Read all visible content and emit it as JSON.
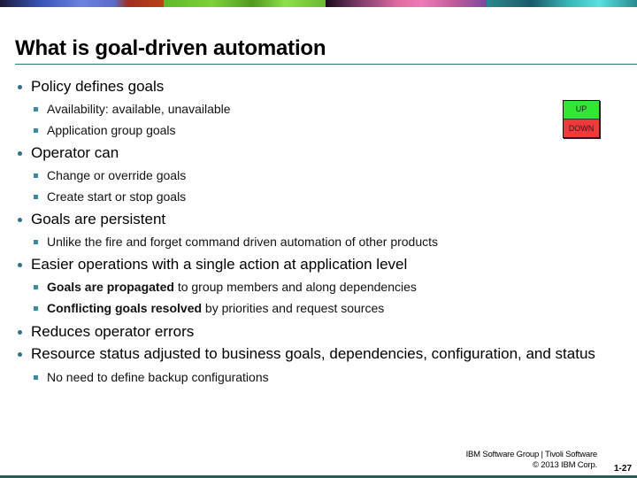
{
  "slide": {
    "title": "What is goal-driven automation",
    "bullets": [
      {
        "text": "Policy defines goals",
        "children": [
          {
            "text": "Availability: available, unavailable"
          },
          {
            "text": "Application group goals"
          }
        ]
      },
      {
        "text": "Operator can",
        "children": [
          {
            "text": "Change or override goals"
          },
          {
            "text": "Create start or stop goals"
          }
        ]
      },
      {
        "text": "Goals are persistent",
        "children": [
          {
            "text": "Unlike the fire and forget command driven automation of other products"
          }
        ]
      },
      {
        "text": "Easier operations with a single action at application level",
        "children": [
          {
            "bold": "Goals are propagated",
            "text": " to group members and along dependencies"
          },
          {
            "bold": "Conflicting goals resolved",
            "text": " by priorities and request sources"
          }
        ]
      },
      {
        "text": "Reduces operator errors",
        "children": []
      },
      {
        "text": "Resource status adjusted to business goals, dependencies, configuration, and status",
        "children": [
          {
            "text": "No need to define backup configurations"
          }
        ]
      }
    ],
    "status_box": {
      "up_label": "UP",
      "down_label": "DOWN",
      "up_color": "#33e633",
      "down_color": "#f03a3a"
    },
    "footer": {
      "line1": "IBM Software Group | Tivoli Software",
      "line2": "© 2013 IBM Corp.",
      "page_number": "1-27"
    },
    "colors": {
      "accent_rule": "#2a7a7a",
      "bullet": "#2e6f8e"
    }
  }
}
